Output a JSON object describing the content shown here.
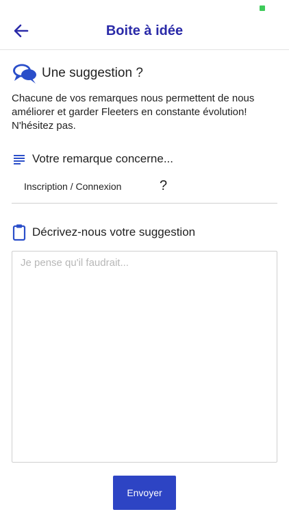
{
  "header": {
    "title": "Boite à idée",
    "back_icon": "arrow-left-icon"
  },
  "suggestion": {
    "icon": "chat-bubbles-icon",
    "title": "Une suggestion ?",
    "intro": "Chacune de vos remarques nous permettent de nous améliorer et garder Fleeters en constante évolution! N'hésitez pas."
  },
  "remark": {
    "icon": "list-lines-icon",
    "title": "Votre remarque concerne...",
    "selected_value": "Inscription / Connexion",
    "help_symbol": "?"
  },
  "description": {
    "icon": "clipboard-icon",
    "title": "Décrivez-nous votre suggestion",
    "placeholder": "Je pense qu'il faudrait...",
    "value": ""
  },
  "actions": {
    "send_label": "Envoyer"
  },
  "colors": {
    "primary": "#2a2aa8",
    "button": "#2d44c4",
    "status": "#3ecb5a"
  }
}
